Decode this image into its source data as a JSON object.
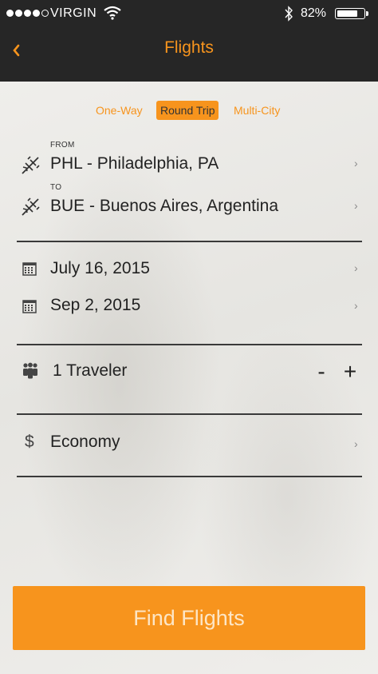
{
  "status_bar": {
    "carrier": "VIRGIN",
    "battery_percent": "82%",
    "signal_bars_filled": 4,
    "battery_level": 0.82
  },
  "nav": {
    "back_icon": "chevron-left-icon",
    "title": "Flights"
  },
  "trip_tabs": [
    {
      "label": "One-Way",
      "active": false
    },
    {
      "label": "Round Trip",
      "active": true
    },
    {
      "label": "Multi-City",
      "active": false
    }
  ],
  "route": {
    "from_label": "FROM",
    "from_value": "PHL - Philadelphia, PA",
    "to_label": "TO",
    "to_value": "BUE - Buenos Aires, Argentina",
    "icon": "plane-icon"
  },
  "dates": {
    "depart": "July 16, 2015",
    "return": "Sep 2, 2015",
    "icon": "calendar-icon"
  },
  "travelers": {
    "label": "1 Traveler",
    "minus": "-",
    "plus": "+",
    "icon": "people-icon"
  },
  "cabin": {
    "icon_glyph": "$",
    "value": "Economy"
  },
  "chevron": "›",
  "actions": {
    "find_label": "Find Flights"
  },
  "colors": {
    "accent": "#f7941d",
    "topbar": "#262626",
    "text": "#222222"
  }
}
